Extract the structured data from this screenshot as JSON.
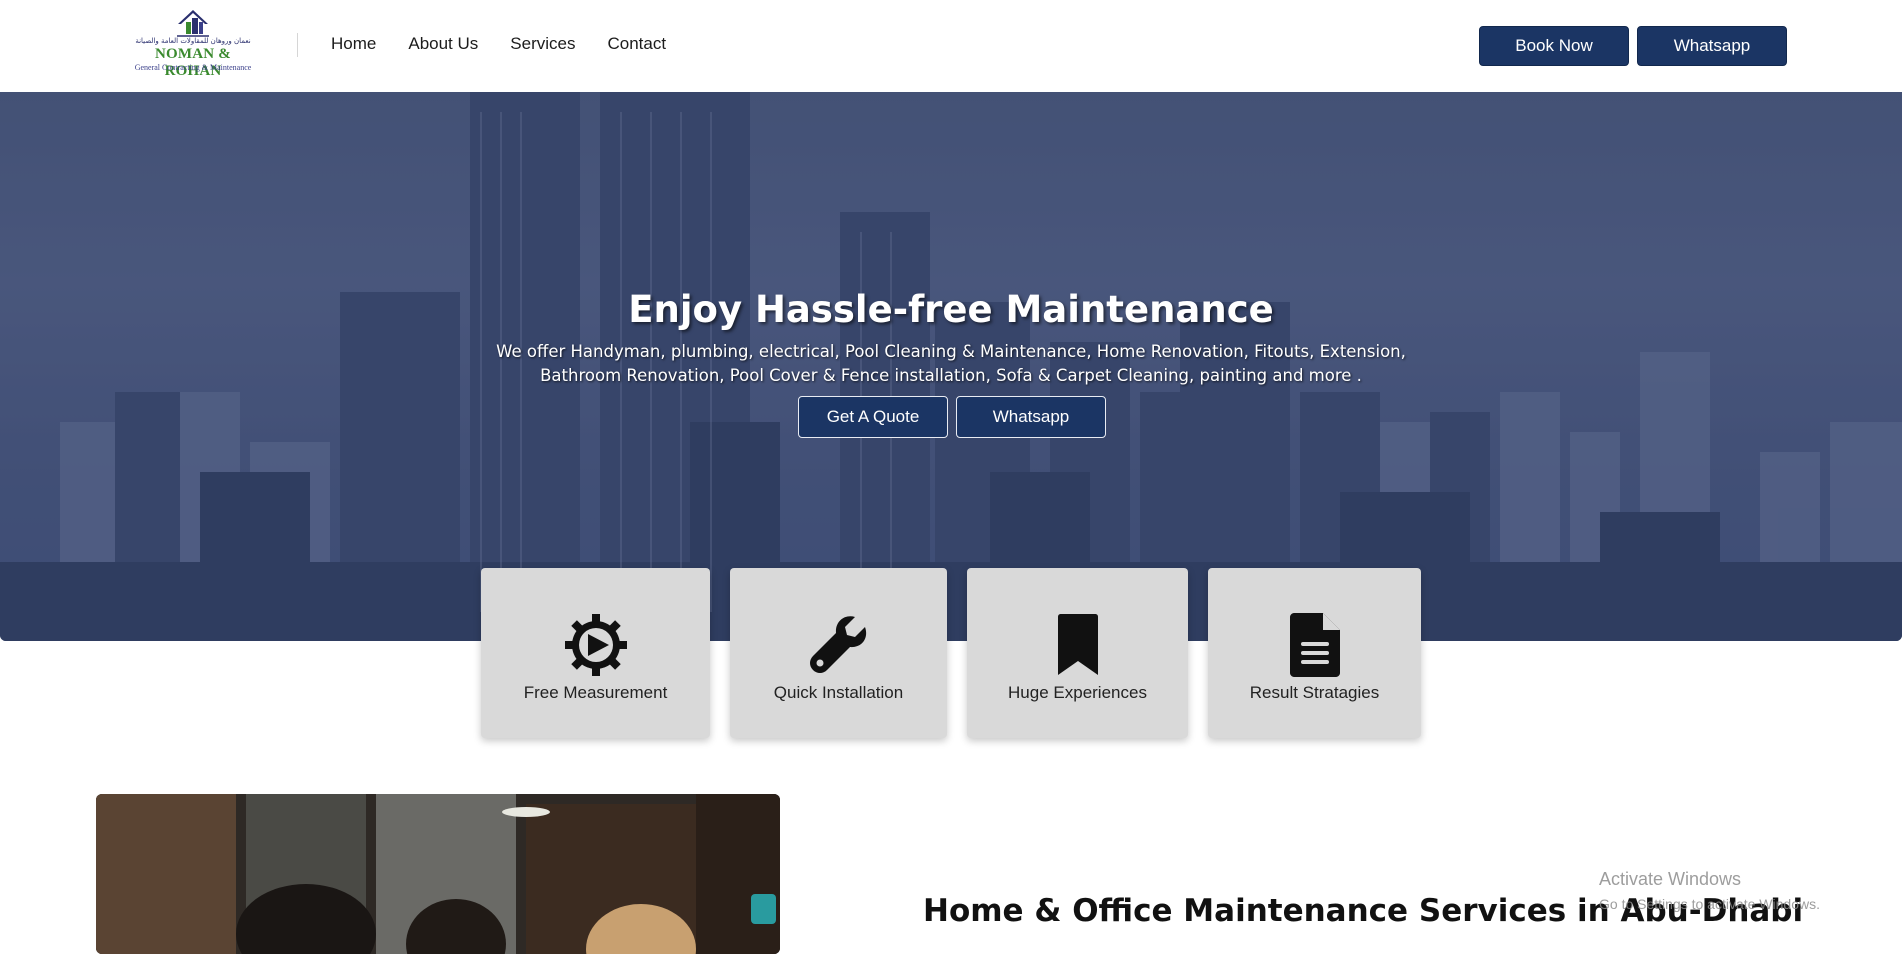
{
  "header": {
    "logo": {
      "arabic_text": "نعمان وروهان للمقاولات العامة والصيانة",
      "name": "NOMAN & ROHAN",
      "tagline": "General Contracting & Maintenance"
    },
    "nav": [
      {
        "label": "Home"
      },
      {
        "label": "About Us"
      },
      {
        "label": "Services"
      },
      {
        "label": "Contact"
      }
    ],
    "book_label": "Book Now",
    "whatsapp_label": "Whatsapp"
  },
  "hero": {
    "title": "Enjoy Hassle-free Maintenance",
    "subtitle": "We offer Handyman, plumbing, electrical, Pool Cleaning & Maintenance, Home Renovation, Fitouts, Extension, Bathroom Renovation, Pool Cover & Fence installation, Sofa & Carpet Cleaning, painting and more .",
    "quote_label": "Get A Quote",
    "whatsapp_label": "Whatsapp"
  },
  "features": [
    {
      "label": "Free Measurement",
      "icon": "gear-play-icon"
    },
    {
      "label": "Quick Installation",
      "icon": "wrench-icon"
    },
    {
      "label": "Huge Experiences",
      "icon": "bookmark-icon"
    },
    {
      "label": "Result Stratagies",
      "icon": "document-icon"
    }
  ],
  "about": {
    "title": "Home & Office Maintenance Services in Abu-Dhabi"
  },
  "windows_watermark": {
    "title": "Activate Windows",
    "subtitle": "Go to Settings to activate Windows."
  },
  "colors": {
    "brand_navy": "#1b3564",
    "logo_green": "#3a8a2e",
    "card_bg": "#d9d9d9"
  }
}
